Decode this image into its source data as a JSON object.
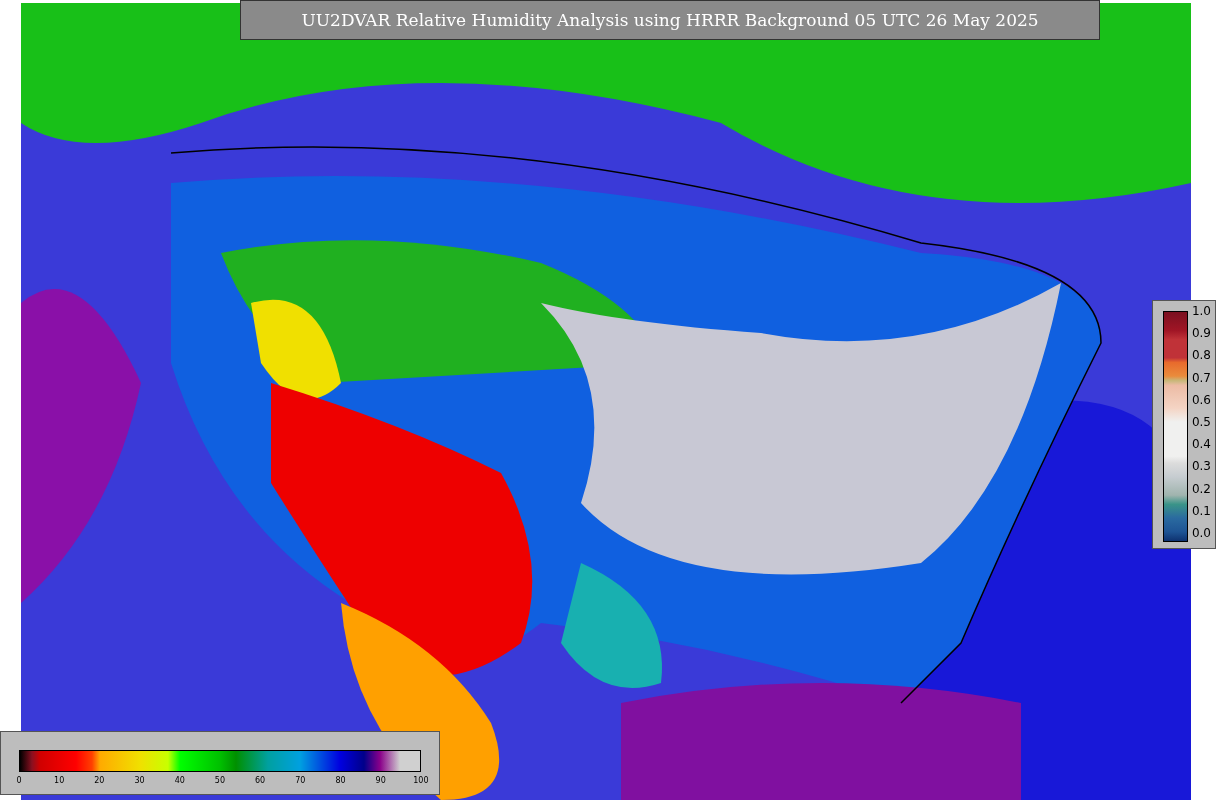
{
  "title": "UU2DVAR Relative Humidity Analysis using HRRR Background 05 UTC 26 May 2025",
  "station_colorbar": {
    "ticks": [
      "1.0",
      "0.9",
      "0.8",
      "0.7",
      "0.6",
      "0.5",
      "0.4",
      "0.3",
      "0.2",
      "0.1",
      "0.0"
    ]
  },
  "humidity_colorbar": {
    "ticks": [
      "0",
      "10",
      "20",
      "30",
      "40",
      "50",
      "60",
      "70",
      "80",
      "90",
      "100"
    ]
  }
}
